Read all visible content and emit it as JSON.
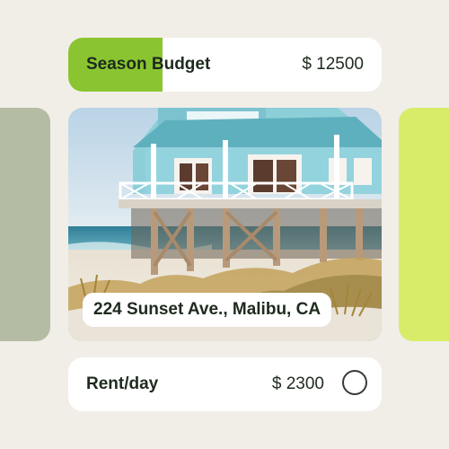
{
  "budget": {
    "label": "Season Budget",
    "value": "$ 12500",
    "used_fraction": 0.3
  },
  "listing": {
    "address": "224 Sunset Ave., Malibu, CA",
    "image_icon": "beach-house-photo"
  },
  "rent": {
    "label": "Rent/day",
    "value": "$ 2300",
    "selected": false
  },
  "colors": {
    "background": "#f1eee8",
    "accent_green": "#8ac531",
    "side_panel_left": "#b5bca4",
    "side_panel_right": "#d8ec6a",
    "card": "#ffffff",
    "text": "#1e2a1e"
  }
}
